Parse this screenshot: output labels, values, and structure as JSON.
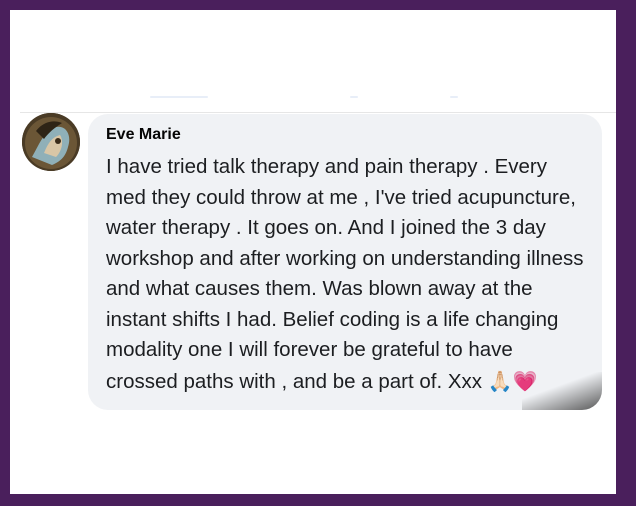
{
  "comment": {
    "author": "Eve Marie",
    "text": "I have tried talk therapy and pain therapy . Every med they could throw at me , I've tried acupuncture, water therapy . It goes on. And I joined the 3 day workshop and after working on understanding illness and what causes them. Was blown away at the instant shifts I had. Belief coding is a life changing modality one I will forever be grateful to have crossed paths with , and be a part of. Xxx",
    "emojis": [
      "🙏🏻",
      "💗"
    ],
    "avatar_icon": "profile-photo"
  },
  "colors": {
    "frame_border": "#4a1f5c",
    "bubble_bg": "#f0f2f5",
    "text": "#1c1e21"
  }
}
